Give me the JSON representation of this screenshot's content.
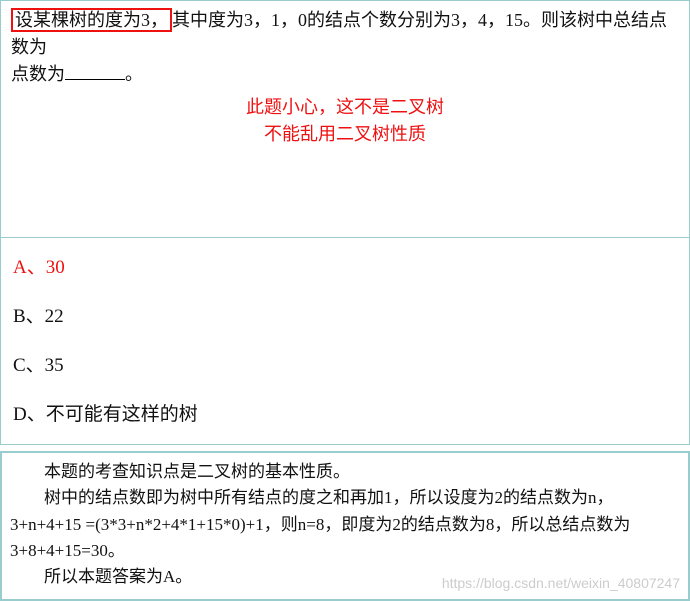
{
  "question": {
    "highlight": "设某棵树的度为3，",
    "rest_before_blank": "其中度为3，1，0的结点个数分别为3，4，15。则该树中总结点数为",
    "rest_after_blank": "。",
    "note_line1": "此题小心，这不是二叉树",
    "note_line2": "不能乱用二叉树性质"
  },
  "options": [
    {
      "label": "A、30",
      "correct": true
    },
    {
      "label": "B、22",
      "correct": false
    },
    {
      "label": "C、35",
      "correct": false
    },
    {
      "label": "D、不可能有这样的树",
      "correct": false
    }
  ],
  "explanation": {
    "p1": "本题的考查知识点是二叉树的基本性质。",
    "p2": "树中的结点数即为树中所有结点的度之和再加1，所以设度为2的结点数为n，3+n+4+15 =(3*3+n*2+4*1+15*0)+1，则n=8，即度为2的结点数为8，所以总结点数为3+8+4+15=30。",
    "p3": "所以本题答案为A。"
  },
  "watermark": "https://blog.csdn.net/weixin_40807247"
}
